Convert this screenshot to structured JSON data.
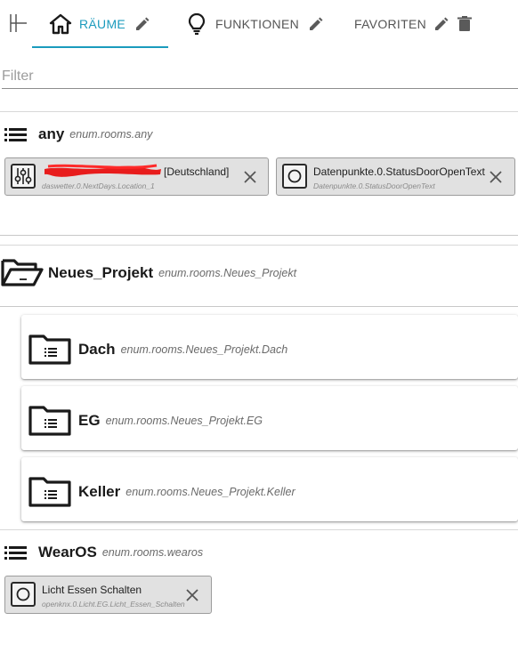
{
  "tabs": [
    {
      "label": "RÄUME",
      "icon": "home-icon",
      "active": true
    },
    {
      "label": "FUNKTIONEN",
      "icon": "lightbulb-icon",
      "active": false
    },
    {
      "label": "FAVORITEN",
      "icon": "star-icon",
      "active": false
    }
  ],
  "accent_color": "#1b9bbd",
  "filter": {
    "placeholder": "Filter",
    "value": ""
  },
  "sections": {
    "any": {
      "title": "any",
      "enum": "enum.rooms.any",
      "chips": [
        {
          "title": "[Deutschland]",
          "subtitle": "daswetter.0.NextDays.Location_1",
          "icon": "sliders-icon"
        },
        {
          "title": "Datenpunkte.0.StatusDoorOpenText",
          "subtitle": "Datenpunkte.0.StatusDoorOpenText",
          "icon": "circle-icon"
        }
      ]
    },
    "neues_projekt": {
      "title": "Neues_Projekt",
      "enum": "enum.rooms.Neues_Projekt",
      "children": [
        {
          "title": "Dach",
          "enum": "enum.rooms.Neues_Projekt.Dach"
        },
        {
          "title": "EG",
          "enum": "enum.rooms.Neues_Projekt.EG"
        },
        {
          "title": "Keller",
          "enum": "enum.rooms.Neues_Projekt.Keller"
        }
      ]
    },
    "wearos": {
      "title": "WearOS",
      "enum": "enum.rooms.wearos",
      "chips": [
        {
          "title": "Licht Essen Schalten",
          "subtitle": "openknx.0.Licht.EG.Licht_Essen_Schalten",
          "icon": "circle-icon"
        }
      ]
    }
  }
}
